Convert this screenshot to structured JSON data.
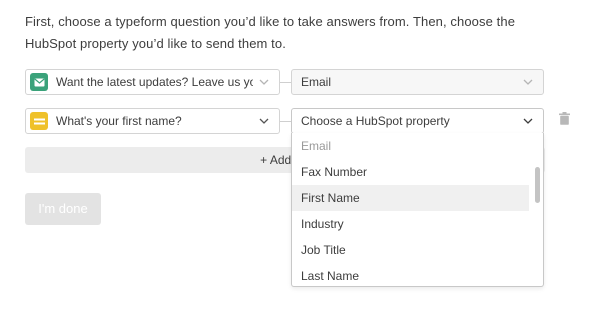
{
  "instructions": {
    "line1": "First, choose a typeform question you’d like to take answers from. Then, choose the",
    "line2": "HubSpot property you’d like to send them to."
  },
  "mappings": [
    {
      "question_icon": "envelope-icon",
      "question_icon_color": "#3aa27a",
      "question": "Want the latest updates? Leave us your",
      "property": "Email"
    },
    {
      "question_icon": "short-text-icon",
      "question_icon_color": "#efc12a",
      "question": "What's your first name?",
      "property_placeholder": "Choose a HubSpot property"
    }
  ],
  "add_button_label": "+ Add an",
  "done_button_label": "I'm done",
  "dropdown": {
    "options": [
      "Email",
      "Fax Number",
      "First Name",
      "Industry",
      "Job Title",
      "Last Name"
    ],
    "disabled_option": "Email",
    "highlighted_option": "First Name"
  },
  "colors": {
    "text": "#3d3d3d",
    "border": "#d4d4d4",
    "disabled_button": "#e3e3e3",
    "hover_row": "#f0f0f0"
  }
}
